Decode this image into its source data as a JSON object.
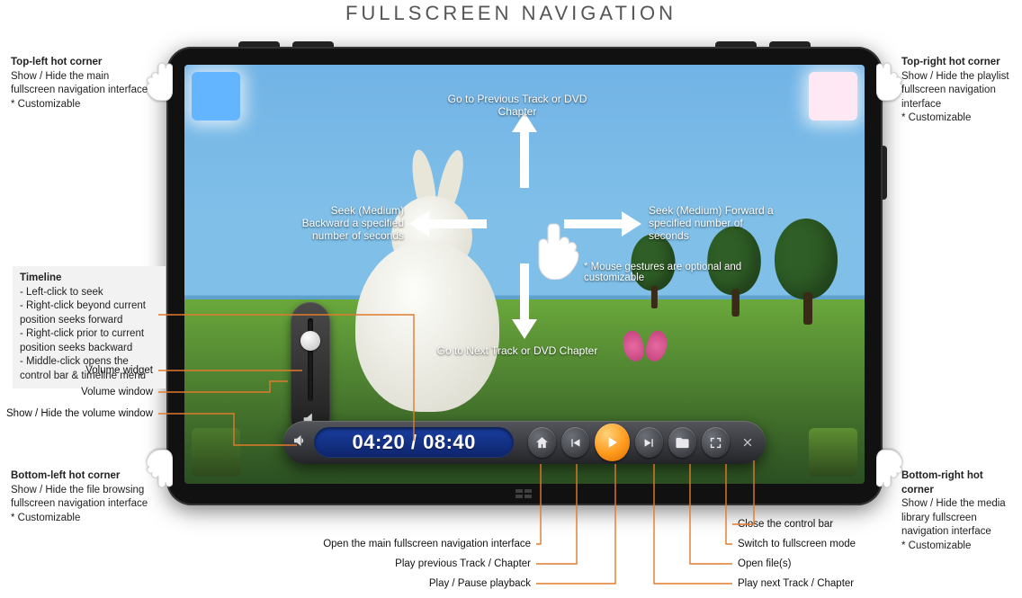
{
  "title": "FULLSCREEN NAVIGATION",
  "hotcorners": {
    "tl": {
      "title": "Top-left hot corner",
      "desc": "Show / Hide the main fullscreen navigation interface",
      "note": "* Customizable"
    },
    "tr": {
      "title": "Top-right hot corner",
      "desc": "Show / Hide the playlist fullscreen navigation interface",
      "note": "* Customizable"
    },
    "bl": {
      "title": "Bottom-left hot corner",
      "desc": "Show / Hide the file browsing fullscreen navigation interface",
      "note": "* Customizable"
    },
    "br": {
      "title": "Bottom-right hot corner",
      "desc": "Show / Hide the media library fullscreen navigation interface",
      "note": "* Customizable"
    }
  },
  "timeline_callout": {
    "title": "Timeline",
    "lines": [
      "- Left-click to seek",
      "- Right-click beyond current position seeks forward",
      "- Right-click prior to current position seeks backward",
      "- Middle-click opens the control bar & timeline menu"
    ]
  },
  "left_labels": {
    "volume_widget": "Volume widget",
    "volume_window": "Volume window",
    "show_hide_volume": "Show / Hide the volume window"
  },
  "gestures": {
    "up": "Go to Previous Track or DVD Chapter",
    "down": "Go to Next Track or DVD Chapter",
    "left": "Seek (Medium) Backward a specified number of seconds",
    "right": "Seek (Medium) Forward a specified number of seconds",
    "note": "* Mouse gestures are optional and customizable"
  },
  "controlbar": {
    "time_current": "04:20",
    "time_sep": " / ",
    "time_total": "08:40"
  },
  "bottom_labels": {
    "home": "Open the main fullscreen navigation interface",
    "prev": "Play previous Track / Chapter",
    "play": "Play / Pause playback",
    "next": "Play next Track / Chapter",
    "open": "Open file(s)",
    "fullscreen": "Switch to fullscreen mode",
    "close": "Close the control bar"
  }
}
